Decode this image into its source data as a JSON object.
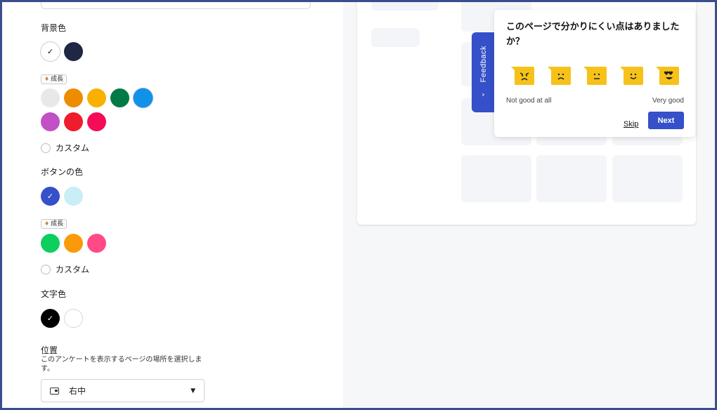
{
  "settings": {
    "background_color": {
      "label": "背景色",
      "swatches": [
        "#ffffff",
        "#1f2744"
      ],
      "selected_index": 0,
      "pro_badge": "成長",
      "pro_swatches": [
        "#e8e8e8",
        "#ee8c00",
        "#f9b000",
        "#017a46",
        "#1092e6",
        "#c250c7",
        "#ef1c2c",
        "#f50c56"
      ],
      "custom_label": "カスタム"
    },
    "button_color": {
      "label": "ボタンの色",
      "swatches": [
        "#3550c8",
        "#c8eef6"
      ],
      "selected_index": 0,
      "pro_badge": "成長",
      "pro_swatches": [
        "#0dcf5d",
        "#fb9a09",
        "#ff4a86"
      ],
      "custom_label": "カスタム"
    },
    "text_color": {
      "label": "文字色",
      "swatches": [
        "#000000",
        "#ffffff"
      ],
      "selected_index": 0
    },
    "position": {
      "label": "位置",
      "description": "このアンケートを表示するページの場所を選択します。",
      "selected": "右中"
    }
  },
  "preview": {
    "feedback_tab": "Feedback",
    "question": "このページで分かりにくい点はありましたか？",
    "faces": [
      "angry",
      "sad",
      "neutral",
      "smile",
      "love"
    ],
    "scale_low": "Not good at all",
    "scale_high": "Very good",
    "skip_label": "Skip",
    "next_label": "Next",
    "accent": "#3550c8"
  },
  "icons": {
    "check": "✓",
    "gem": "♦",
    "caret": "▼",
    "chevron": "›"
  }
}
